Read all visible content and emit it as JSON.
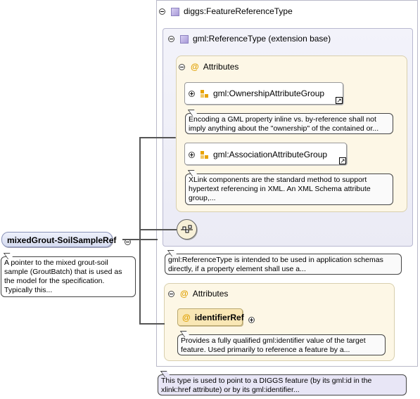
{
  "root": {
    "label": "mixedGrout-SoilSampleRef",
    "doc": "A pointer to the mixed grout-soil sample (GroutBatch) that is used as the model for the specification. Typically this..."
  },
  "type": {
    "label": "diggs:FeatureReferenceType",
    "doc": "This type is used to point to a DIGGS feature (by its gml:id in the xlink:href attribute) or by its gml:identifier..."
  },
  "base": {
    "label": "gml:ReferenceType (extension base)",
    "doc": "gml:ReferenceType is intended to be used in application schemas directly, if a property element shall use a..."
  },
  "inner_attributes": {
    "label": "Attributes",
    "groups": [
      {
        "label": "gml:OwnershipAttributeGroup",
        "doc": "Encoding a GML property inline vs. by-reference shall not imply anything about the \"ownership\" of the contained or..."
      },
      {
        "label": "gml:AssociationAttributeGroup",
        "doc": "XLink components are the standard method to support hypertext referencing in XML. An XML Schema attribute group,..."
      }
    ]
  },
  "outer_attributes": {
    "label": "Attributes",
    "attr": {
      "label": "identifierRef",
      "doc": "Provides a fully qualified gml:identifier value of the target feature. Used primarily to reference a feature by a..."
    }
  },
  "icons": {
    "collapse": "minus-circle-icon",
    "expand": "plus-circle-icon",
    "complex_type": "purple-square-icon",
    "attribute": "at-sign-icon",
    "group": "attribute-group-icon",
    "reference": "reference-arrow-icon",
    "sequence": "sequence-compositor-icon"
  },
  "colors": {
    "attribute_box": "#fdf7e6",
    "type_box": "#ebebf5",
    "attribute_icon": "#e0a000"
  }
}
